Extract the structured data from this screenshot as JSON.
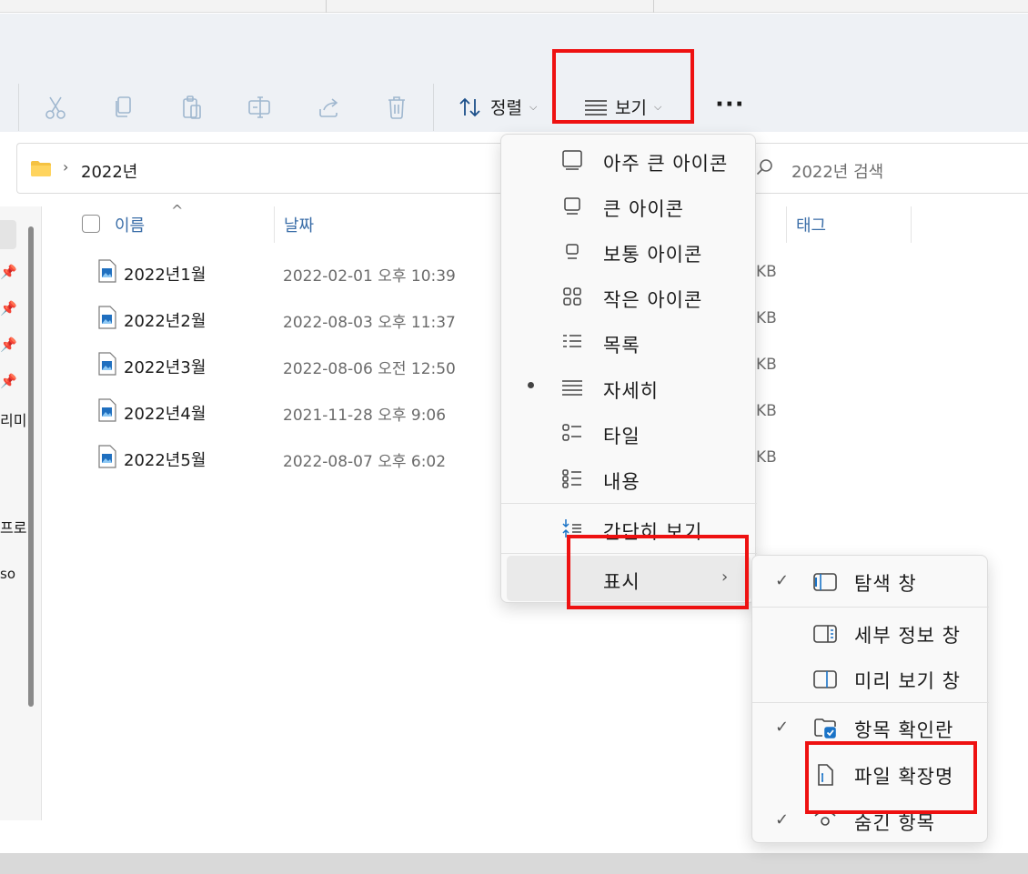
{
  "toolbar": {
    "sort_label": "정렬",
    "view_label": "보기",
    "more_label": "···"
  },
  "address": {
    "crumb": "2022년",
    "search_placeholder": "2022년 검색"
  },
  "nav_fragments": [
    "리미",
    "프로",
    "so"
  ],
  "list": {
    "headers": [
      "이름",
      "날짜",
      "태그"
    ],
    "rows": [
      {
        "name": "2022년1월",
        "date": "2022-02-01 오후 10:39",
        "size": "KB"
      },
      {
        "name": "2022년2월",
        "date": "2022-08-03 오후 11:37",
        "size": "KB"
      },
      {
        "name": "2022년3월",
        "date": "2022-08-06 오전 12:50",
        "size": "KB"
      },
      {
        "name": "2022년4월",
        "date": "2021-11-28 오후 9:06",
        "size": "KB"
      },
      {
        "name": "2022년5월",
        "date": "2022-08-07 오후 6:02",
        "size": "KB"
      }
    ]
  },
  "view_menu": {
    "items": [
      {
        "label": "아주 큰 아이콘",
        "icon": "extra-large-icons-icon"
      },
      {
        "label": "큰 아이콘",
        "icon": "large-icons-icon"
      },
      {
        "label": "보통 아이콘",
        "icon": "medium-icons-icon"
      },
      {
        "label": "작은 아이콘",
        "icon": "small-icons-icon"
      },
      {
        "label": "목록",
        "icon": "list-icon"
      },
      {
        "label": "자세히",
        "icon": "details-icon",
        "selected": true
      },
      {
        "label": "타일",
        "icon": "tiles-icon"
      },
      {
        "label": "내용",
        "icon": "content-icon"
      },
      {
        "label": "간단히 보기",
        "icon": "compact-view-icon"
      },
      {
        "label": "표시",
        "icon": "",
        "has_submenu": true
      }
    ]
  },
  "show_submenu": {
    "items": [
      {
        "label": "탐색 창",
        "checked": true,
        "icon": "navigation-pane-icon"
      },
      {
        "label": "세부 정보 창",
        "checked": false,
        "icon": "details-pane-icon"
      },
      {
        "label": "미리 보기 창",
        "checked": false,
        "icon": "preview-pane-icon"
      },
      {
        "label": "항목 확인란",
        "checked": true,
        "icon": "item-checkbox-icon"
      },
      {
        "label": "파일 확장명",
        "checked": false,
        "icon": "file-extension-icon"
      },
      {
        "label": "숨긴 항목",
        "checked": true,
        "icon": "hidden-items-icon"
      }
    ]
  },
  "colors": {
    "highlight": "#ee1111",
    "header_text": "#3b6ea8",
    "accent": "#1a73c7"
  }
}
